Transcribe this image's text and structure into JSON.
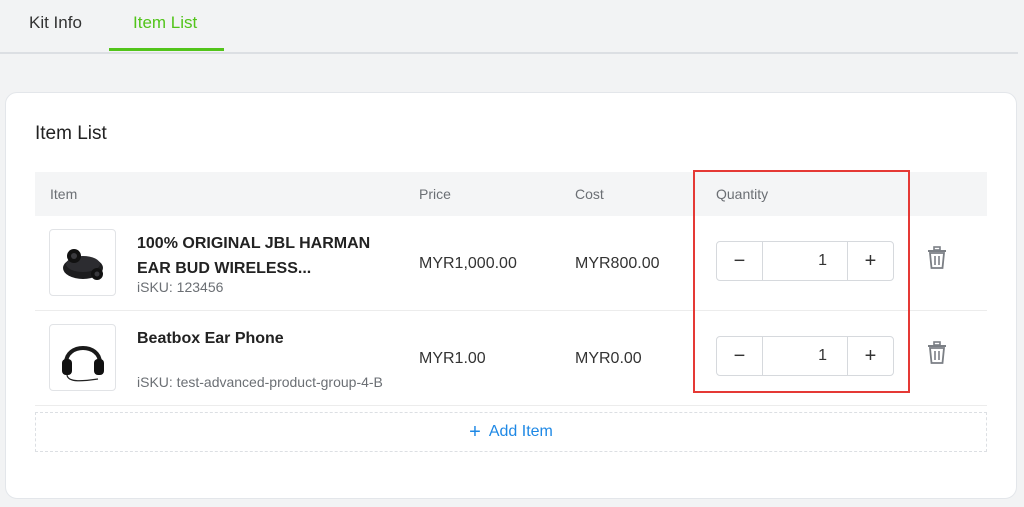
{
  "tabs": [
    {
      "label": "Kit Info"
    },
    {
      "label": "Item List"
    }
  ],
  "card": {
    "title": "Item List"
  },
  "table": {
    "columns": [
      "Item",
      "Price",
      "Cost",
      "Quantity"
    ],
    "rows": [
      {
        "name": "100% ORIGINAL JBL HARMAN EAR BUD WIRELESS...",
        "sku": "iSKU: 123456",
        "price": "MYR1,000.00",
        "cost": "MYR800.00",
        "quantity": "1"
      },
      {
        "name": "Beatbox Ear Phone",
        "sku": "iSKU: test-advanced-product-group-4-B",
        "price": "MYR1.00",
        "cost": "MYR0.00",
        "quantity": "1"
      }
    ]
  },
  "actions": {
    "minus": "−",
    "plus": "+",
    "add_icon": "+",
    "add_label": "Add Item"
  },
  "colors": {
    "active_tab": "#52c41a",
    "link": "#1e88e5",
    "highlight": "#e53935"
  },
  "icons": [
    "earbuds-product-image",
    "headphones-product-image",
    "trash-icon",
    "plus-icon"
  ]
}
